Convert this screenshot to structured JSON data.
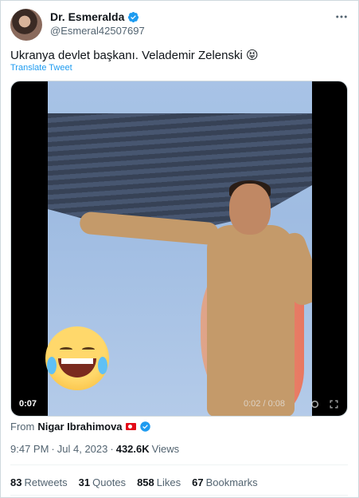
{
  "author": {
    "display_name": "Dr. Esmeralda",
    "handle": "@Esmeral42507697"
  },
  "tweet": {
    "text": "Ukranya devlet başkanı. Velademir Zelenski 😝",
    "translate_label": "Translate Tweet"
  },
  "media": {
    "timestamp": "0:07",
    "controls_text": "0:02 / 0:08"
  },
  "source": {
    "from_label": "From",
    "name": "Nigar Ibrahimova"
  },
  "meta": {
    "time": "9:47 PM",
    "date": "Jul 4, 2023",
    "separator": "·",
    "views_count": "432.6K",
    "views_label": "Views"
  },
  "stats": [
    {
      "count": "83",
      "label": "Retweets"
    },
    {
      "count": "31",
      "label": "Quotes"
    },
    {
      "count": "858",
      "label": "Likes"
    },
    {
      "count": "67",
      "label": "Bookmarks"
    }
  ],
  "colors": {
    "accent": "#1d9bf0",
    "text": "#0f1419",
    "secondary": "#536471"
  },
  "icons": {
    "verified": "verified-badge-icon",
    "more": "more-options-icon"
  }
}
